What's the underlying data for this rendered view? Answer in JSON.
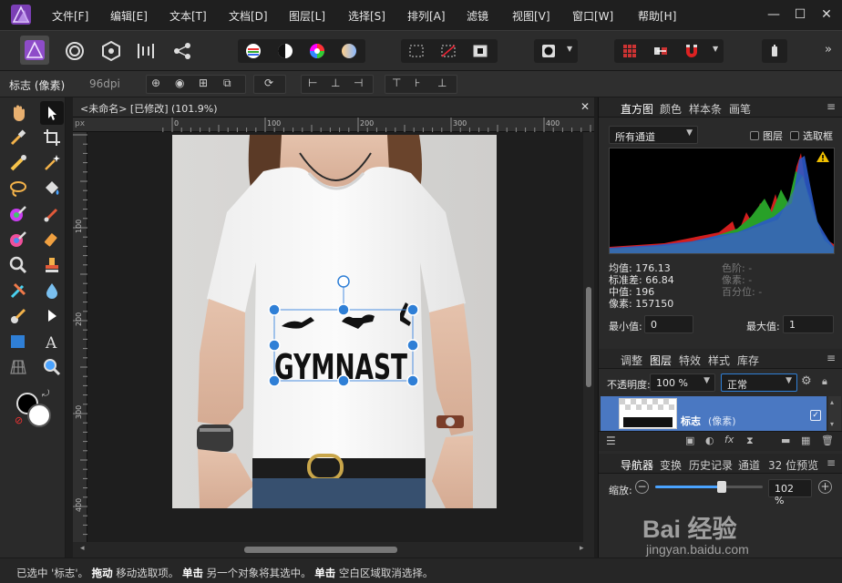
{
  "menubar": {
    "items": [
      "文件[F]",
      "编辑[E]",
      "文本[T]",
      "文档[D]",
      "图层[L]",
      "选择[S]",
      "排列[A]",
      "滤镜",
      "视图[V]",
      "窗口[W]",
      "帮助[H]"
    ]
  },
  "window": {
    "minimize": "—",
    "maximize": "☐",
    "close": "✕"
  },
  "context_bar": {
    "layer_label": "标志 (像素)",
    "dpi": "96dpi"
  },
  "document": {
    "tab_title": "<未命名> [已修改] (101.9%)",
    "ruler_unit": "px",
    "ruler_top_ticks": [
      "0",
      "100",
      "200",
      "300",
      "400"
    ],
    "ruler_left_ticks": [
      "100",
      "200",
      "300",
      "400"
    ],
    "logo_text": "GYMNAST"
  },
  "histogram_panel": {
    "tabs": [
      "直方图",
      "颜色",
      "样本条",
      "画笔"
    ],
    "channel": "所有通道",
    "layer_check": "图层",
    "marquee_check": "选取框",
    "stats_left": [
      "均值: 176.13",
      "标准差: 66.84",
      "中值: 196",
      "像素: 157150"
    ],
    "stats_right": [
      "色阶: -",
      "像素: -",
      "百分位: -"
    ],
    "min_label": "最小值:",
    "min_value": "0",
    "max_label": "最大值:",
    "max_value": "1"
  },
  "layers_panel": {
    "tabs": [
      "调整",
      "图层",
      "特效",
      "样式",
      "库存"
    ],
    "opacity_label": "不透明度:",
    "opacity_value": "100 %",
    "blend_mode": "正常",
    "layer_name": "标志",
    "layer_type": "(像素)"
  },
  "navigator_panel": {
    "tabs": [
      "导航器",
      "变换",
      "历史记录",
      "通道",
      "32 位预览"
    ],
    "zoom_label": "缩放:",
    "zoom_value": "102 %",
    "zoom_fraction": 0.62
  },
  "statusbar": {
    "p1": "已选中 '标志'。",
    "b1": "拖动",
    "p2": " 移动选取项。",
    "b2": "单击",
    "p3": " 另一个对象将其选中。",
    "b3": "单击",
    "p4": " 空白区域取消选择。"
  },
  "watermark": {
    "brand": "Bai 经验",
    "url": "jingyan.baidu.com"
  },
  "colors": {
    "accent": "#2f7fd6",
    "brand_purple": "#9b59d0",
    "selected_layer": "#4a78c2"
  }
}
